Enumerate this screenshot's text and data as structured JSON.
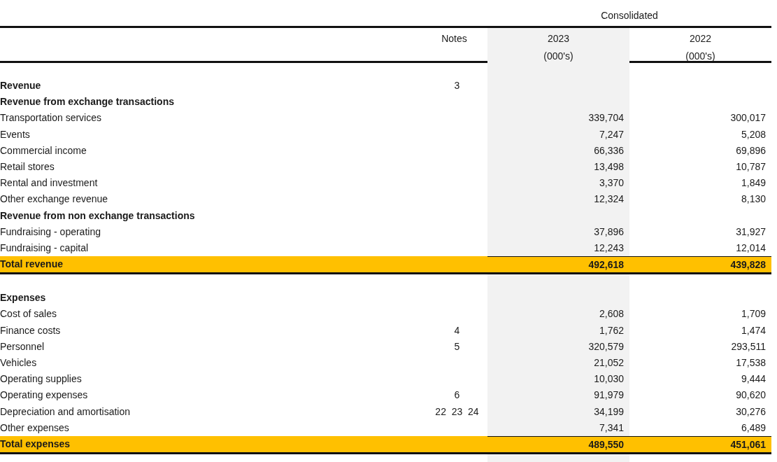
{
  "header": {
    "group": "Consolidated",
    "notes_label": "Notes",
    "columns": [
      {
        "year": "2023",
        "unit": "(000's)",
        "shaded": true
      },
      {
        "year": "2022",
        "unit": "(000's)",
        "shaded": false
      }
    ]
  },
  "sections": [
    {
      "rows": [
        {
          "kind": "heading",
          "label": "Revenue",
          "notes": "3"
        },
        {
          "kind": "heading",
          "label": "Revenue from exchange transactions"
        },
        {
          "kind": "item",
          "label": "Transportation services",
          "values": [
            "339,704",
            "300,017"
          ]
        },
        {
          "kind": "item",
          "label": "Events",
          "values": [
            "7,247",
            "5,208"
          ]
        },
        {
          "kind": "item",
          "label": "Commercial income",
          "values": [
            "66,336",
            "69,896"
          ]
        },
        {
          "kind": "item",
          "label": "Retail stores",
          "values": [
            "13,498",
            "10,787"
          ]
        },
        {
          "kind": "item",
          "label": "Rental and investment",
          "values": [
            "3,370",
            "1,849"
          ]
        },
        {
          "kind": "item",
          "label": "Other exchange revenue",
          "values": [
            "12,324",
            "8,130"
          ]
        },
        {
          "kind": "heading",
          "label": "Revenue from non exchange transactions"
        },
        {
          "kind": "item",
          "label": "Fundraising - operating",
          "values": [
            "37,896",
            "31,927"
          ]
        },
        {
          "kind": "item",
          "label": "Fundraising - capital",
          "values": [
            "12,243",
            "12,014"
          ]
        },
        {
          "kind": "total",
          "label": "Total revenue",
          "values": [
            "492,618",
            "439,828"
          ]
        }
      ]
    },
    {
      "rows": [
        {
          "kind": "heading",
          "label": "Expenses"
        },
        {
          "kind": "item",
          "label": "Cost of sales",
          "values": [
            "2,608",
            "1,709"
          ]
        },
        {
          "kind": "item",
          "label": "Finance costs",
          "notes": "4",
          "values": [
            "1,762",
            "1,474"
          ]
        },
        {
          "kind": "item",
          "label": "Personnel",
          "notes": "5",
          "values": [
            "320,579",
            "293,511"
          ]
        },
        {
          "kind": "item",
          "label": "Vehicles",
          "values": [
            "21,052",
            "17,538"
          ]
        },
        {
          "kind": "item",
          "label": "Operating supplies",
          "values": [
            "10,030",
            "9,444"
          ]
        },
        {
          "kind": "item",
          "label": "Operating expenses",
          "notes": "6",
          "values": [
            "91,979",
            "90,620"
          ]
        },
        {
          "kind": "item",
          "label": "Depreciation and amortisation",
          "notes": "22  23  24",
          "values": [
            "34,199",
            "30,276"
          ]
        },
        {
          "kind": "item",
          "label": "Other expenses",
          "values": [
            "7,341",
            "6,489"
          ]
        },
        {
          "kind": "total",
          "label": "Total expenses",
          "values": [
            "489,550",
            "451,061"
          ]
        }
      ]
    }
  ]
}
